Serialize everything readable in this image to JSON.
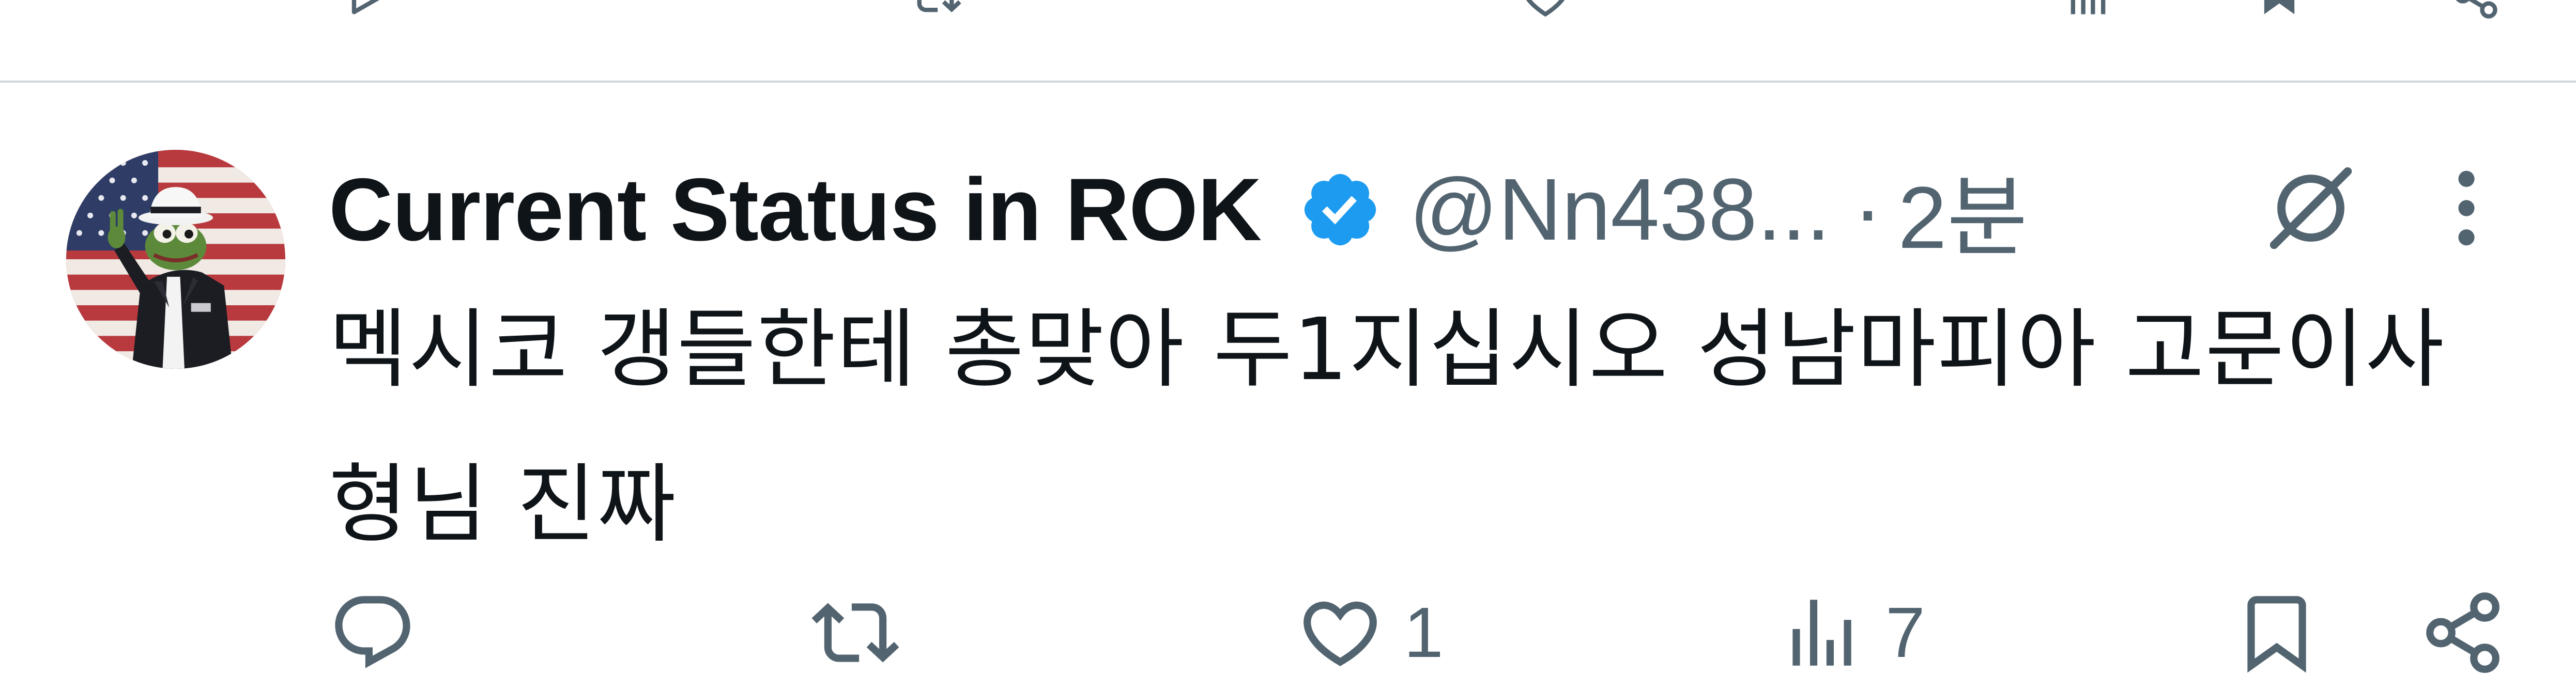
{
  "previous_tweet": {
    "actions": [
      {
        "name": "play-icon"
      },
      {
        "name": "retweet-icon"
      },
      {
        "name": "heart-icon"
      },
      {
        "name": "views-icon"
      },
      {
        "name": "bookmark-icon"
      },
      {
        "name": "share-icon"
      }
    ]
  },
  "tweet": {
    "author": {
      "display_name": "Current Status in ROK",
      "verified": true,
      "handle": "@Nn438...",
      "avatar_icon": "frog-in-suit-flag-avatar"
    },
    "separator": "·",
    "timestamp": "2분",
    "text_line_1": "멕시코 갱들한테 총맞아 두1지십시오 성남마피아 고문이사",
    "text_line_2": "형님 진짜",
    "actions": {
      "reply": {
        "icon": "reply-icon",
        "count": ""
      },
      "retweet": {
        "icon": "retweet-icon",
        "count": ""
      },
      "like": {
        "icon": "heart-icon",
        "count": "1"
      },
      "views": {
        "icon": "views-icon",
        "count": "7"
      },
      "bookmark": {
        "icon": "bookmark-icon"
      },
      "share": {
        "icon": "share-icon"
      }
    }
  },
  "colors": {
    "text_primary": "#0f1419",
    "text_secondary": "#536471",
    "verified_blue": "#1d9bf0",
    "divider": "#d0d5d9"
  }
}
